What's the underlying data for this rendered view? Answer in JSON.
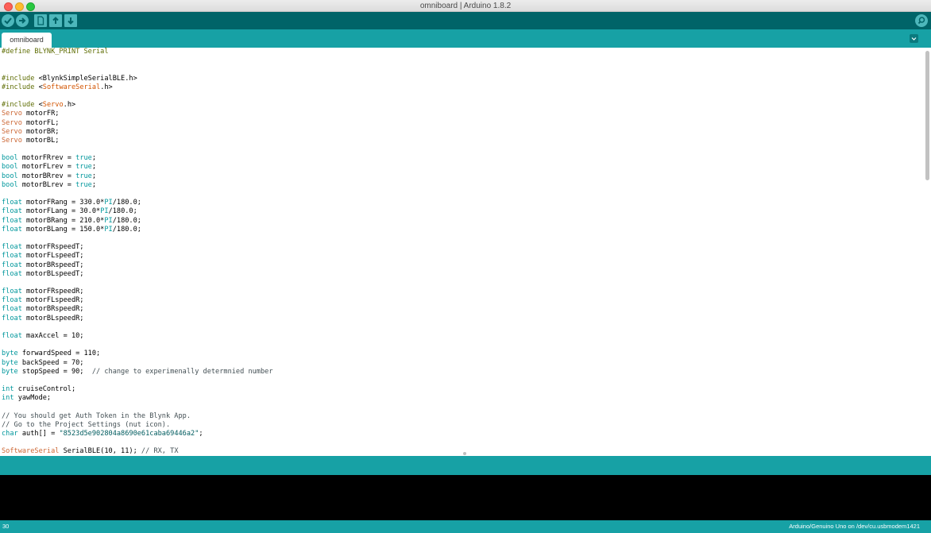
{
  "window": {
    "title": "omniboard | Arduino 1.8.2"
  },
  "toolbar": {
    "buttons": [
      {
        "name": "verify",
        "icon": "check-icon"
      },
      {
        "name": "upload",
        "icon": "arrow-right-icon"
      },
      {
        "name": "new",
        "icon": "new-file-icon"
      },
      {
        "name": "open",
        "icon": "arrow-up-icon"
      },
      {
        "name": "save",
        "icon": "arrow-down-icon"
      }
    ],
    "serial_monitor_icon": "magnifier-icon"
  },
  "tabs": [
    {
      "label": "omniboard",
      "active": true
    }
  ],
  "editor": {
    "lines": [
      [
        {
          "t": "#define BLYNK_PRINT Serial",
          "c": "t-pp"
        }
      ],
      [],
      [],
      [
        {
          "t": "#include ",
          "c": "t-pp"
        },
        {
          "t": "<BlynkSimpleSerialBLE.h>",
          "c": ""
        }
      ],
      [
        {
          "t": "#include ",
          "c": "t-pp"
        },
        {
          "t": "<",
          "c": ""
        },
        {
          "t": "SoftwareSerial",
          "c": "t-inc"
        },
        {
          "t": ".h>",
          "c": ""
        }
      ],
      [],
      [
        {
          "t": "#include ",
          "c": "t-pp"
        },
        {
          "t": "<",
          "c": ""
        },
        {
          "t": "Servo",
          "c": "t-inc"
        },
        {
          "t": ".h>",
          "c": ""
        }
      ],
      [
        {
          "t": "Servo",
          "c": "t-type"
        },
        {
          "t": " motorFR;",
          "c": ""
        }
      ],
      [
        {
          "t": "Servo",
          "c": "t-type"
        },
        {
          "t": " motorFL;",
          "c": ""
        }
      ],
      [
        {
          "t": "Servo",
          "c": "t-type"
        },
        {
          "t": " motorBR;",
          "c": ""
        }
      ],
      [
        {
          "t": "Servo",
          "c": "t-type"
        },
        {
          "t": " motorBL;",
          "c": ""
        }
      ],
      [],
      [
        {
          "t": "bool",
          "c": "t-kw"
        },
        {
          "t": " motorFRrev = ",
          "c": ""
        },
        {
          "t": "true",
          "c": "t-kw"
        },
        {
          "t": ";",
          "c": ""
        }
      ],
      [
        {
          "t": "bool",
          "c": "t-kw"
        },
        {
          "t": " motorFLrev = ",
          "c": ""
        },
        {
          "t": "true",
          "c": "t-kw"
        },
        {
          "t": ";",
          "c": ""
        }
      ],
      [
        {
          "t": "bool",
          "c": "t-kw"
        },
        {
          "t": " motorBRrev = ",
          "c": ""
        },
        {
          "t": "true",
          "c": "t-kw"
        },
        {
          "t": ";",
          "c": ""
        }
      ],
      [
        {
          "t": "bool",
          "c": "t-kw"
        },
        {
          "t": " motorBLrev = ",
          "c": ""
        },
        {
          "t": "true",
          "c": "t-kw"
        },
        {
          "t": ";",
          "c": ""
        }
      ],
      [],
      [
        {
          "t": "float",
          "c": "t-kw"
        },
        {
          "t": " motorFRang = 330.0*",
          "c": ""
        },
        {
          "t": "PI",
          "c": "t-kw"
        },
        {
          "t": "/180.0;",
          "c": ""
        }
      ],
      [
        {
          "t": "float",
          "c": "t-kw"
        },
        {
          "t": " motorFLang = 30.0*",
          "c": ""
        },
        {
          "t": "PI",
          "c": "t-kw"
        },
        {
          "t": "/180.0;",
          "c": ""
        }
      ],
      [
        {
          "t": "float",
          "c": "t-kw"
        },
        {
          "t": " motorBRang = 210.0*",
          "c": ""
        },
        {
          "t": "PI",
          "c": "t-kw"
        },
        {
          "t": "/180.0;",
          "c": ""
        }
      ],
      [
        {
          "t": "float",
          "c": "t-kw"
        },
        {
          "t": " motorBLang = 150.0*",
          "c": ""
        },
        {
          "t": "PI",
          "c": "t-kw"
        },
        {
          "t": "/180.0;",
          "c": ""
        }
      ],
      [],
      [
        {
          "t": "float",
          "c": "t-kw"
        },
        {
          "t": " motorFRspeedT;",
          "c": ""
        }
      ],
      [
        {
          "t": "float",
          "c": "t-kw"
        },
        {
          "t": " motorFLspeedT;",
          "c": ""
        }
      ],
      [
        {
          "t": "float",
          "c": "t-kw"
        },
        {
          "t": " motorBRspeedT;",
          "c": ""
        }
      ],
      [
        {
          "t": "float",
          "c": "t-kw"
        },
        {
          "t": " motorBLspeedT;",
          "c": ""
        }
      ],
      [],
      [
        {
          "t": "float",
          "c": "t-kw"
        },
        {
          "t": " motorFRspeedR;",
          "c": ""
        }
      ],
      [
        {
          "t": "float",
          "c": "t-kw"
        },
        {
          "t": " motorFLspeedR;",
          "c": ""
        }
      ],
      [
        {
          "t": "float",
          "c": "t-kw"
        },
        {
          "t": " motorBRspeedR;",
          "c": ""
        }
      ],
      [
        {
          "t": "float",
          "c": "t-kw"
        },
        {
          "t": " motorBLspeedR;",
          "c": ""
        }
      ],
      [],
      [
        {
          "t": "float",
          "c": "t-kw"
        },
        {
          "t": " maxAccel = 10;",
          "c": ""
        }
      ],
      [],
      [
        {
          "t": "byte",
          "c": "t-kw"
        },
        {
          "t": " forwardSpeed = 110;",
          "c": ""
        }
      ],
      [
        {
          "t": "byte",
          "c": "t-kw"
        },
        {
          "t": " backSpeed = 70;",
          "c": ""
        }
      ],
      [
        {
          "t": "byte",
          "c": "t-kw"
        },
        {
          "t": " stopSpeed = 90;  ",
          "c": ""
        },
        {
          "t": "// change to experimenally determnied number",
          "c": "t-cmt"
        }
      ],
      [],
      [
        {
          "t": "int",
          "c": "t-kw"
        },
        {
          "t": " cruiseControl;",
          "c": ""
        }
      ],
      [
        {
          "t": "int",
          "c": "t-kw"
        },
        {
          "t": " yawMode;",
          "c": ""
        }
      ],
      [],
      [
        {
          "t": "// You should get Auth Token in the Blynk App.",
          "c": "t-cmt"
        }
      ],
      [
        {
          "t": "// Go to the Project Settings (nut icon).",
          "c": "t-cmt"
        }
      ],
      [
        {
          "t": "char",
          "c": "t-kw"
        },
        {
          "t": " auth[] = ",
          "c": ""
        },
        {
          "t": "\"8523d5e902804a8690e61caba69446a2\"",
          "c": "t-str"
        },
        {
          "t": ";",
          "c": ""
        }
      ],
      [],
      [
        {
          "t": "SoftwareSerial",
          "c": "t-type"
        },
        {
          "t": " SerialBLE(10, 11); ",
          "c": ""
        },
        {
          "t": "// RX, TX",
          "c": "t-cmt"
        }
      ]
    ]
  },
  "status": {
    "line_number": "30",
    "board": "Arduino/Genuino Uno on /dev/cu.usbmodem1421"
  },
  "colors": {
    "toolbar": "#006468",
    "tabstrip": "#17a1a5",
    "button": "#4db7bb",
    "console": "#000000"
  }
}
